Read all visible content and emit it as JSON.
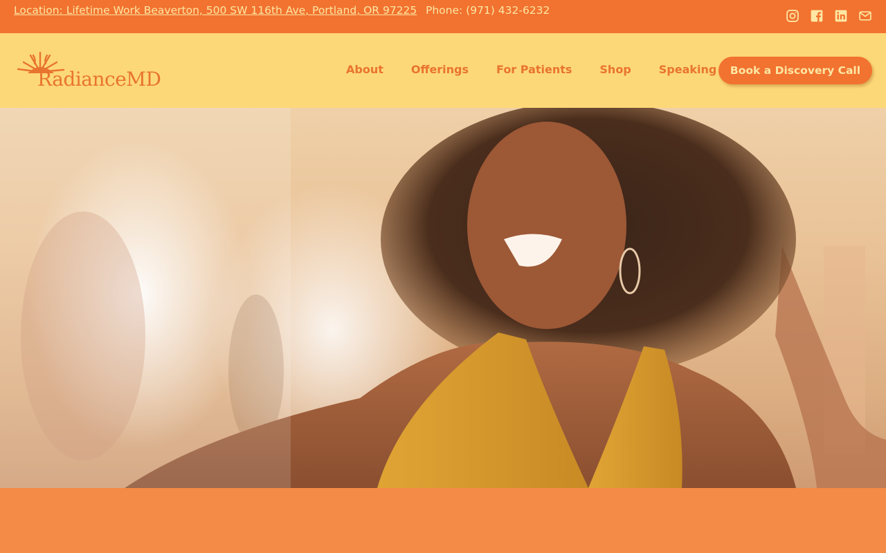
{
  "topbar": {
    "location": "Location: Lifetime Work Beaverton, 500 SW 116th Ave, Portland, OR 97225",
    "phone": "Phone: (971) 432-6232",
    "social": [
      "instagram-icon",
      "facebook-icon",
      "linkedin-icon",
      "mail-icon"
    ]
  },
  "header": {
    "logo_text": "RadianceMD",
    "nav": [
      "About",
      "Offerings",
      "For Patients",
      "Shop",
      "Speaking"
    ],
    "cta": "Book a Discovery Call"
  },
  "colors": {
    "topbar_bg": "#f2722f",
    "header_bg": "#fdd878",
    "accent": "#e8742e",
    "band_bg": "#f48b46",
    "light_text": "#fde7a3"
  }
}
